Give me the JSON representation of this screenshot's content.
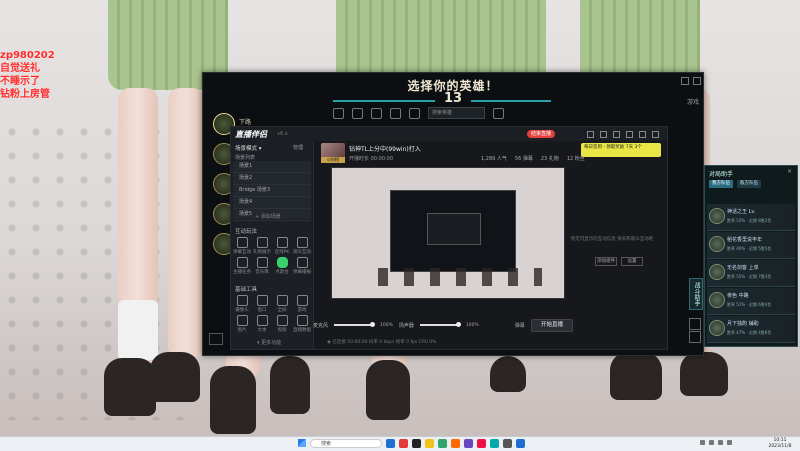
{
  "stream_overlay": {
    "lines": [
      "zp980202",
      "自觉送礼",
      "不睡示了",
      "钻粉上房管"
    ]
  },
  "lol_client": {
    "title": "选择你的英雄！",
    "timer": "13",
    "player_label": "下路",
    "search_placeholder": "搜索英雄",
    "side_button": "战斗助手",
    "help_text": "游戏"
  },
  "streaming_app": {
    "logo": "直播伴侣",
    "version": "v6.x",
    "side_panel": {
      "header": "场景模式 ▾",
      "manage": "管理",
      "scene_label": "场景列表",
      "scenes": [
        "场景1",
        "场景2",
        "Bridge 场景3",
        "场景4",
        "场景5"
      ],
      "add_scene": "+ 添加场景",
      "section_common": "互动玩法",
      "section_tools": "基础工具",
      "more": "▾ 更多功能",
      "tools_common": [
        "弹幕互动",
        "礼物展示",
        "连线PK",
        "观众互动",
        "主播任务",
        "音乐库",
        "点歌台",
        "弹幕播报"
      ],
      "tools_basic": [
        "摄像头",
        "窗口",
        "全屏",
        "游戏",
        "图片",
        "文本",
        "视频",
        "直播数据"
      ]
    },
    "user": {
      "name": "钻神TL上分中(99win)打入",
      "meta": "开播时长 00:00:00",
      "badge": "小时榜"
    },
    "end_button": "结束直播",
    "sign_badge": "每日签到 · 领取奖励  7天  3个",
    "stats": [
      "1,289 人气",
      "56 弹幕",
      "23 礼物",
      "12 粉丝"
    ],
    "empty_tip": "暂无可显示的互动信息 快去和观众互动吧",
    "tip_buttons": [
      "添加组件",
      "设置"
    ],
    "bottom": {
      "mic_label": "麦克风",
      "mic_value": "100%",
      "spk_label": "扬声器",
      "spk_value": "100%",
      "icons": [
        "弹幕",
        "美颜",
        "设置"
      ],
      "live_button": "开始直播",
      "status": "◉ 已连接 00:00:00  码率 0 kbps  帧率 0 fps  CPU 0%"
    }
  },
  "right_panel": {
    "title": "对局助手",
    "tabs": [
      "我方队伍",
      "敌方队伍"
    ],
    "players": [
      {
        "name": "神话之王 Lv.",
        "status": "胜率 52% · 近期 8胜2负"
      },
      {
        "name": "稻花香里说丰年",
        "status": "胜率 49% · 近期 5胜5负"
      },
      {
        "name": "无名剑客 上单",
        "status": "胜率 55% · 近期 7胜3负"
      },
      {
        "name": "夜色 中路",
        "status": "胜率 51% · 近期 6胜4负"
      },
      {
        "name": "月下独酌 辅助",
        "status": "胜率 47% · 近期 4胜6负"
      }
    ]
  },
  "taskbar": {
    "search_placeholder": "搜索",
    "clock_time": "10:11",
    "clock_date": "2023/11/8",
    "app_colors": [
      "#1f6fd1",
      "#e23a3a",
      "#222222",
      "#f0c419",
      "#30a46c",
      "#ff6a00",
      "#6b46c1",
      "#e14",
      "#0aa",
      "#555",
      "#1f6fd1"
    ]
  }
}
